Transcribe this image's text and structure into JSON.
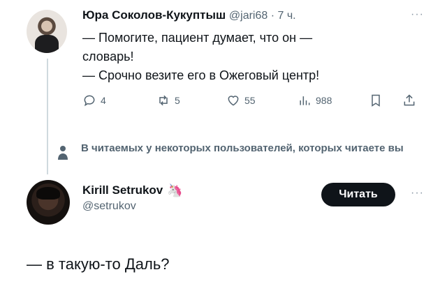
{
  "tweet1": {
    "author_name": "Юра Соколов-Кукуптыш",
    "handle": "@jari68",
    "separator": " · ",
    "time": "7 ч.",
    "more": "···",
    "lines": [
      "— Помогите, пациент думает, что он —",
      "словарь!",
      "— Срочно везите его в Ожеговый центр!"
    ],
    "actions": {
      "replies": "4",
      "retweets": "5",
      "likes": "55",
      "views": "988"
    }
  },
  "notice": {
    "text": "В читаемых у некоторых пользователей, которых читаете вы"
  },
  "tweet2": {
    "author_name": "Kirill Setrukov",
    "emoji": "🦄",
    "handle": "@setrukov",
    "follow_label": "Читать",
    "more": "···",
    "text": "— в такую-то Даль?"
  },
  "icons": {
    "reply": "reply-icon",
    "retweet": "retweet-icon",
    "like": "heart-icon",
    "views": "views-icon",
    "bookmark": "bookmark-icon",
    "share": "share-icon",
    "notice": "person-icon"
  }
}
